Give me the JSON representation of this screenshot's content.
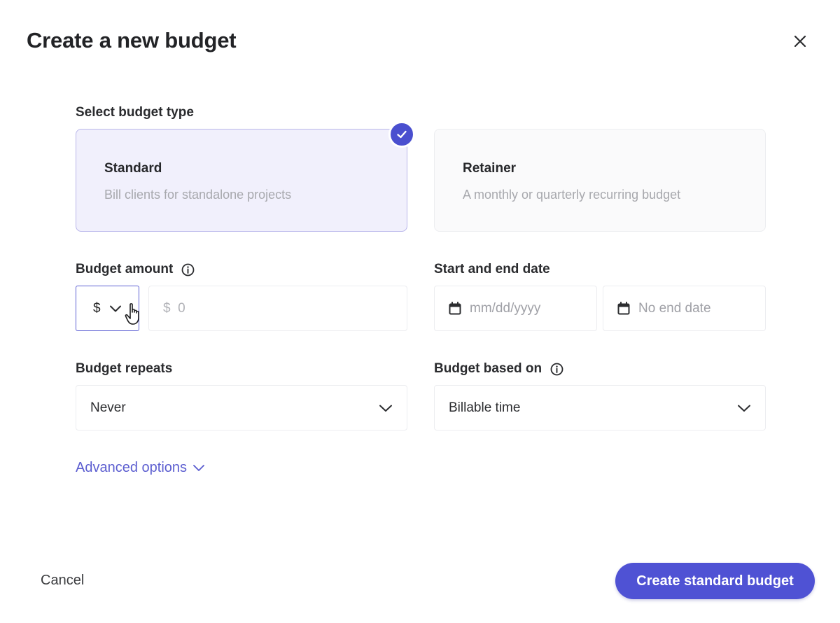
{
  "dialog": {
    "title": "Create a new budget",
    "close_icon": "close-icon"
  },
  "budget_type": {
    "label": "Select budget type",
    "options": [
      {
        "title": "Standard",
        "description": "Bill clients for standalone projects",
        "selected": true
      },
      {
        "title": "Retainer",
        "description": "A monthly or quarterly recurring budget",
        "selected": false
      }
    ]
  },
  "budget_amount": {
    "label": "Budget amount",
    "currency": "$",
    "placeholder": "$  0"
  },
  "dates": {
    "label": "Start and end date",
    "start_placeholder": "mm/dd/yyyy",
    "end_placeholder": "No end date"
  },
  "budget_repeats": {
    "label": "Budget repeats",
    "value": "Never"
  },
  "budget_based_on": {
    "label": "Budget based on",
    "value": "Billable time"
  },
  "advanced_options": "Advanced options",
  "footer": {
    "cancel": "Cancel",
    "create": "Create standard budget"
  },
  "colors": {
    "accent": "#4f52d4",
    "selected_card_bg": "#f1f0fc",
    "link": "#5c5ed0"
  }
}
